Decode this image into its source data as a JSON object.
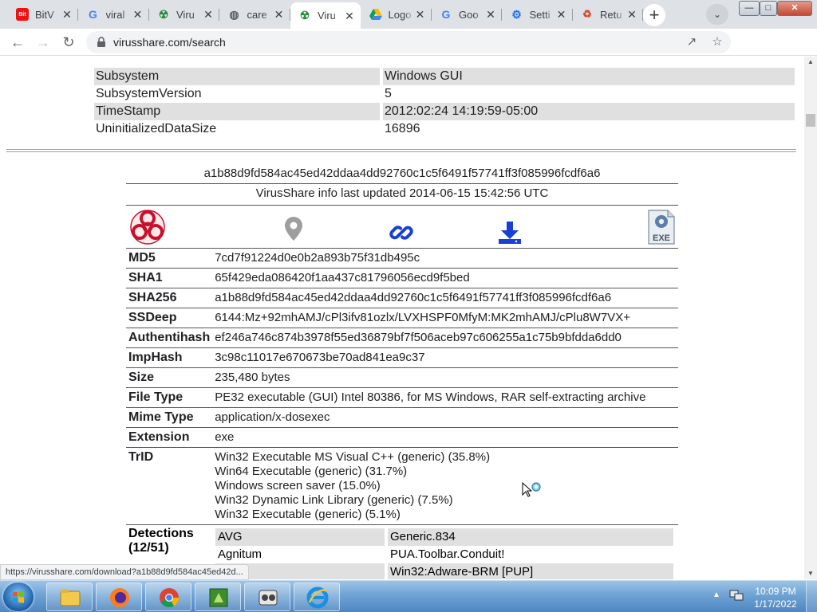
{
  "browser": {
    "tabs": [
      {
        "title": "BitV",
        "favicon": "bitdefender-icon",
        "fav_text": "Bit",
        "active": false
      },
      {
        "title": "viral",
        "favicon": "google-icon",
        "fav_text": "G",
        "active": false
      },
      {
        "title": "Viru",
        "favicon": "virusshare-icon",
        "fav_text": "",
        "active": false
      },
      {
        "title": "care",
        "favicon": "globe-icon",
        "fav_text": "",
        "active": false
      },
      {
        "title": "Viru",
        "favicon": "virusshare-icon",
        "fav_text": "",
        "active": true
      },
      {
        "title": "Logo",
        "favicon": "google-drive-icon",
        "fav_text": "",
        "active": false
      },
      {
        "title": "Goo",
        "favicon": "google-icon",
        "fav_text": "G",
        "active": false
      },
      {
        "title": "Setti",
        "favicon": "settings-gear-icon",
        "fav_text": "",
        "active": false
      },
      {
        "title": "Retu",
        "favicon": "recycle-icon",
        "fav_text": "",
        "active": false
      }
    ],
    "url": "virusshare.com/search",
    "status_url": "https://virusshare.com/download?a1b88d9fd584ac45ed42d..."
  },
  "pe_info": [
    {
      "key": "Subsystem",
      "value": "Windows GUI",
      "shaded": true
    },
    {
      "key": "SubsystemVersion",
      "value": "5",
      "shaded": false
    },
    {
      "key": "TimeStamp",
      "value": "2012:02:24 14:19:59-05:00",
      "shaded": true
    },
    {
      "key": "UninitializedDataSize",
      "value": "16896",
      "shaded": false
    }
  ],
  "sample": {
    "sha256_title": "a1b88d9fd584ac45ed42ddaa4dd92760c1c5f6491f57741ff3f085996fcdf6a6",
    "info_updated": "VirusShare info last updated 2014-06-15 15:42:56 UTC",
    "icons": [
      "biohazard-icon",
      "location-pin-icon",
      "link-icon",
      "download-icon",
      "exe-file-icon"
    ],
    "rows": [
      {
        "label": "MD5",
        "value": "7cd7f91224d0e0b2a893b75f31db495c"
      },
      {
        "label": "SHA1",
        "value": "65f429eda086420f1aa437c81796056ecd9f5bed"
      },
      {
        "label": "SHA256",
        "value": "a1b88d9fd584ac45ed42ddaa4dd92760c1c5f6491f57741ff3f085996fcdf6a6"
      },
      {
        "label": "SSDeep",
        "value": "6144:Mz+92mhAMJ/cPl3ifv81ozlx/LVXHSPF0MfyM:MK2mhAMJ/cPlu8W7VX+"
      },
      {
        "label": "Authentihash",
        "value": "ef246a746c874b3978f55ed36879bf7f506aceb97c606255a1c75b9bfdda6dd0"
      },
      {
        "label": "ImpHash",
        "value": "3c98c11017e670673be70ad841ea9c37"
      },
      {
        "label": "Size",
        "value": "235,480 bytes"
      },
      {
        "label": "File Type",
        "value": "PE32 executable (GUI) Intel 80386, for MS Windows, RAR self-extracting archive"
      },
      {
        "label": "Mime Type",
        "value": "application/x-dosexec"
      },
      {
        "label": "Extension",
        "value": "exe"
      }
    ],
    "trid_label": "TrID",
    "trid": [
      "Win32 Executable MS Visual C++ (generic) (35.8%)",
      "Win64 Executable (generic) (31.7%)",
      "Windows screen saver (15.0%)",
      "Win32 Dynamic Link Library (generic) (7.5%)",
      "Win32 Executable (generic) (5.1%)"
    ],
    "detections_label": "Detections (12/51)",
    "detections": [
      {
        "engine": "AVG",
        "result": "Generic.834",
        "shaded": true
      },
      {
        "engine": "Agnitum",
        "result": "PUA.Toolbar.Conduit!",
        "shaded": false
      },
      {
        "engine": "",
        "result": "Win32:Adware-BRM [PUP]",
        "shaded": true
      }
    ]
  },
  "taskbar": {
    "items": [
      "file-explorer-icon",
      "firefox-icon",
      "chrome-icon",
      "green-app-icon",
      "media-player-icon",
      "internet-explorer-icon"
    ],
    "time": "10:09 PM",
    "date": "1/17/2022"
  },
  "colors": {
    "tab_strip": "#dee1e6",
    "row_shade": "#e0e0e0",
    "link_blue": "#1a3fd6",
    "biohazard_red": "#c8102e",
    "profile_red": "#d9333a"
  }
}
